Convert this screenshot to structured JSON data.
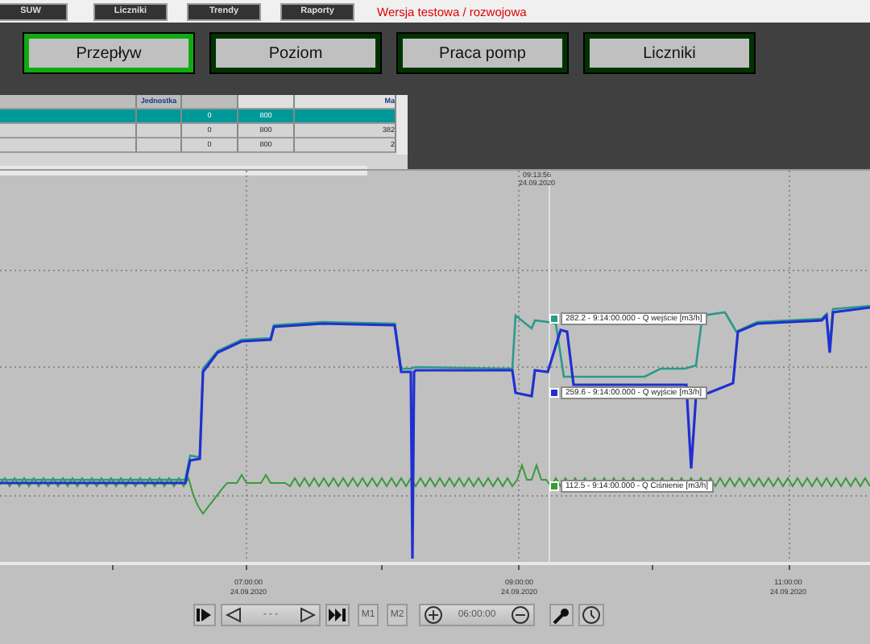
{
  "top_tabs": [
    {
      "label": "SUW",
      "selected": false
    },
    {
      "label": "Liczniki",
      "selected": false
    },
    {
      "label": "Trendy",
      "selected": false
    },
    {
      "label": "Raporty",
      "selected": false
    }
  ],
  "version_note": "Wersja testowa / rozwojowa",
  "nav_buttons": [
    {
      "label": "Przepływ",
      "selected": true
    },
    {
      "label": "Poziom",
      "selected": false
    },
    {
      "label": "Praca pomp",
      "selected": false
    },
    {
      "label": "Liczniki",
      "selected": false
    }
  ],
  "table": {
    "columns": [
      "",
      "Jednostka",
      "",
      "",
      "Ma"
    ],
    "rows": [
      {
        "cells": [
          "",
          "",
          "0",
          "800",
          ""
        ],
        "selected": true
      },
      {
        "cells": [
          "",
          "",
          "0",
          "800",
          "382"
        ],
        "selected": false
      },
      {
        "cells": [
          "",
          "",
          "0",
          "800",
          "2"
        ],
        "selected": false
      }
    ]
  },
  "chart": {
    "cursor_time": "09:13:56",
    "cursor_date": "24.09.2020",
    "tooltips": [
      {
        "text": "282.2 - 9:14:00.000 - Q wejście [m3/h]",
        "color": "#2a9a8a"
      },
      {
        "text": "259.6 - 9:14:00.000 - Q wyjście [m3/h]",
        "color": "#2030d0"
      },
      {
        "text": "112.5 - 9:14:00.000 - Q Ciśnienie [m3/h]",
        "color": "#3a9a3a"
      }
    ],
    "x_labels": [
      {
        "time": "07:00:00",
        "date": "24.09.2020"
      },
      {
        "time": "09:00:00",
        "date": "24.09.2020"
      },
      {
        "time": "11:00:00",
        "date": "24.09.2020"
      }
    ]
  },
  "controls": {
    "position_label": "- - -",
    "markers": [
      "M1",
      "M2"
    ],
    "zoom_span": "06:00:00"
  }
}
